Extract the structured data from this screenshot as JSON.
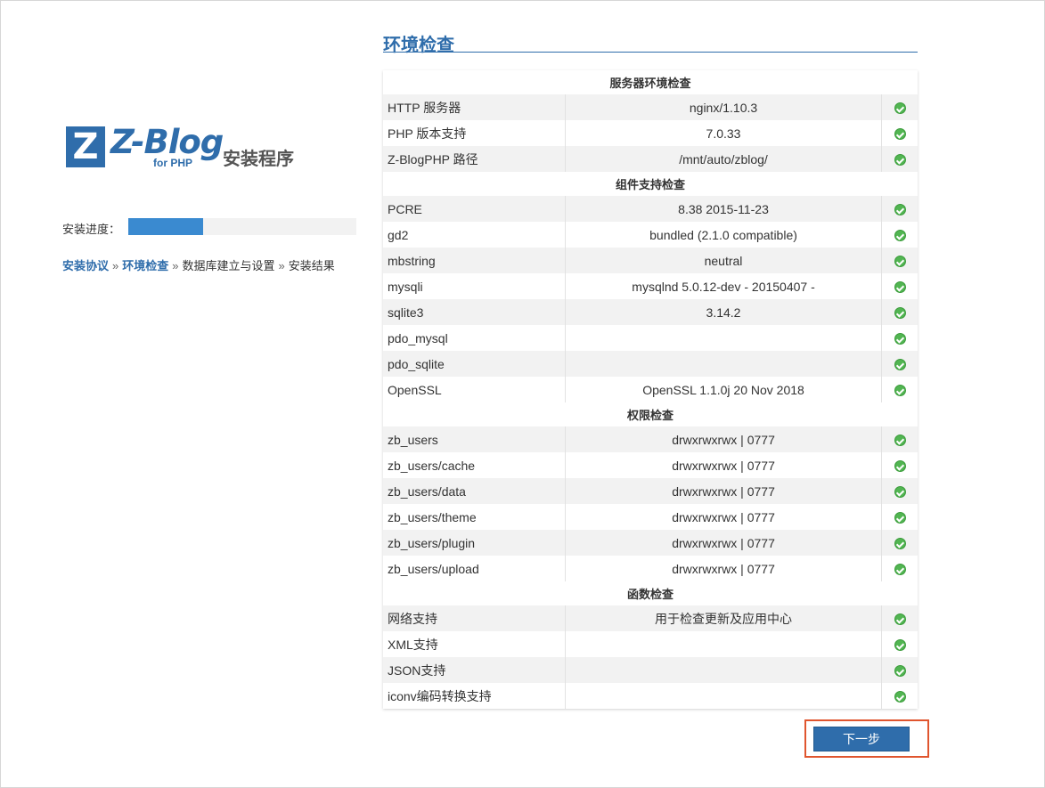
{
  "logo": {
    "letter": "Z",
    "word": "Z-Blog",
    "sub": "for PHP",
    "title": "安装程序"
  },
  "progress": {
    "label": "安装进度：",
    "value": 0.33
  },
  "steps": [
    {
      "label": "安装协议",
      "done": true
    },
    {
      "label": "环境检查",
      "done": true
    },
    {
      "label": "数据库建立与设置",
      "done": false
    },
    {
      "label": "安装结果",
      "done": false
    }
  ],
  "steps_separator": "»",
  "page_title": "环境检查",
  "sections": [
    {
      "title": "服务器环境检查",
      "rows": [
        {
          "name": "HTTP 服务器",
          "value": "nginx/1.10.3"
        },
        {
          "name": "PHP 版本支持",
          "value": "7.0.33"
        },
        {
          "name": "Z-BlogPHP 路径",
          "value": "/mnt/auto/zblog/"
        }
      ]
    },
    {
      "title": "组件支持检查",
      "rows": [
        {
          "name": "PCRE",
          "value": "8.38 2015-11-23"
        },
        {
          "name": "gd2",
          "value": "bundled (2.1.0 compatible)"
        },
        {
          "name": "mbstring",
          "value": "neutral"
        },
        {
          "name": "mysqli",
          "value": "mysqlnd 5.0.12-dev - 20150407 -"
        },
        {
          "name": "sqlite3",
          "value": "3.14.2"
        },
        {
          "name": "pdo_mysql",
          "value": ""
        },
        {
          "name": "pdo_sqlite",
          "value": ""
        },
        {
          "name": "OpenSSL",
          "value": "OpenSSL 1.1.0j 20 Nov 2018"
        }
      ]
    },
    {
      "title": "权限检查",
      "rows": [
        {
          "name": "zb_users",
          "value": "drwxrwxrwx | 0777"
        },
        {
          "name": "zb_users/cache",
          "value": "drwxrwxrwx | 0777"
        },
        {
          "name": "zb_users/data",
          "value": "drwxrwxrwx | 0777"
        },
        {
          "name": "zb_users/theme",
          "value": "drwxrwxrwx | 0777"
        },
        {
          "name": "zb_users/plugin",
          "value": "drwxrwxrwx | 0777"
        },
        {
          "name": "zb_users/upload",
          "value": "drwxrwxrwx | 0777"
        }
      ]
    },
    {
      "title": "函数检查",
      "rows": [
        {
          "name": "网络支持",
          "value": "用于检查更新及应用中心"
        },
        {
          "name": "XML支持",
          "value": ""
        },
        {
          "name": "JSON支持",
          "value": ""
        },
        {
          "name": "iconv编码转换支持",
          "value": ""
        }
      ]
    }
  ],
  "status_icon": "check-circle-icon",
  "colors": {
    "accent": "#2f6dab",
    "progress_fill": "#3a8ad0",
    "ok_green": "#52b552",
    "highlight": "#e0552e"
  },
  "next_button": {
    "label": "下一步"
  }
}
